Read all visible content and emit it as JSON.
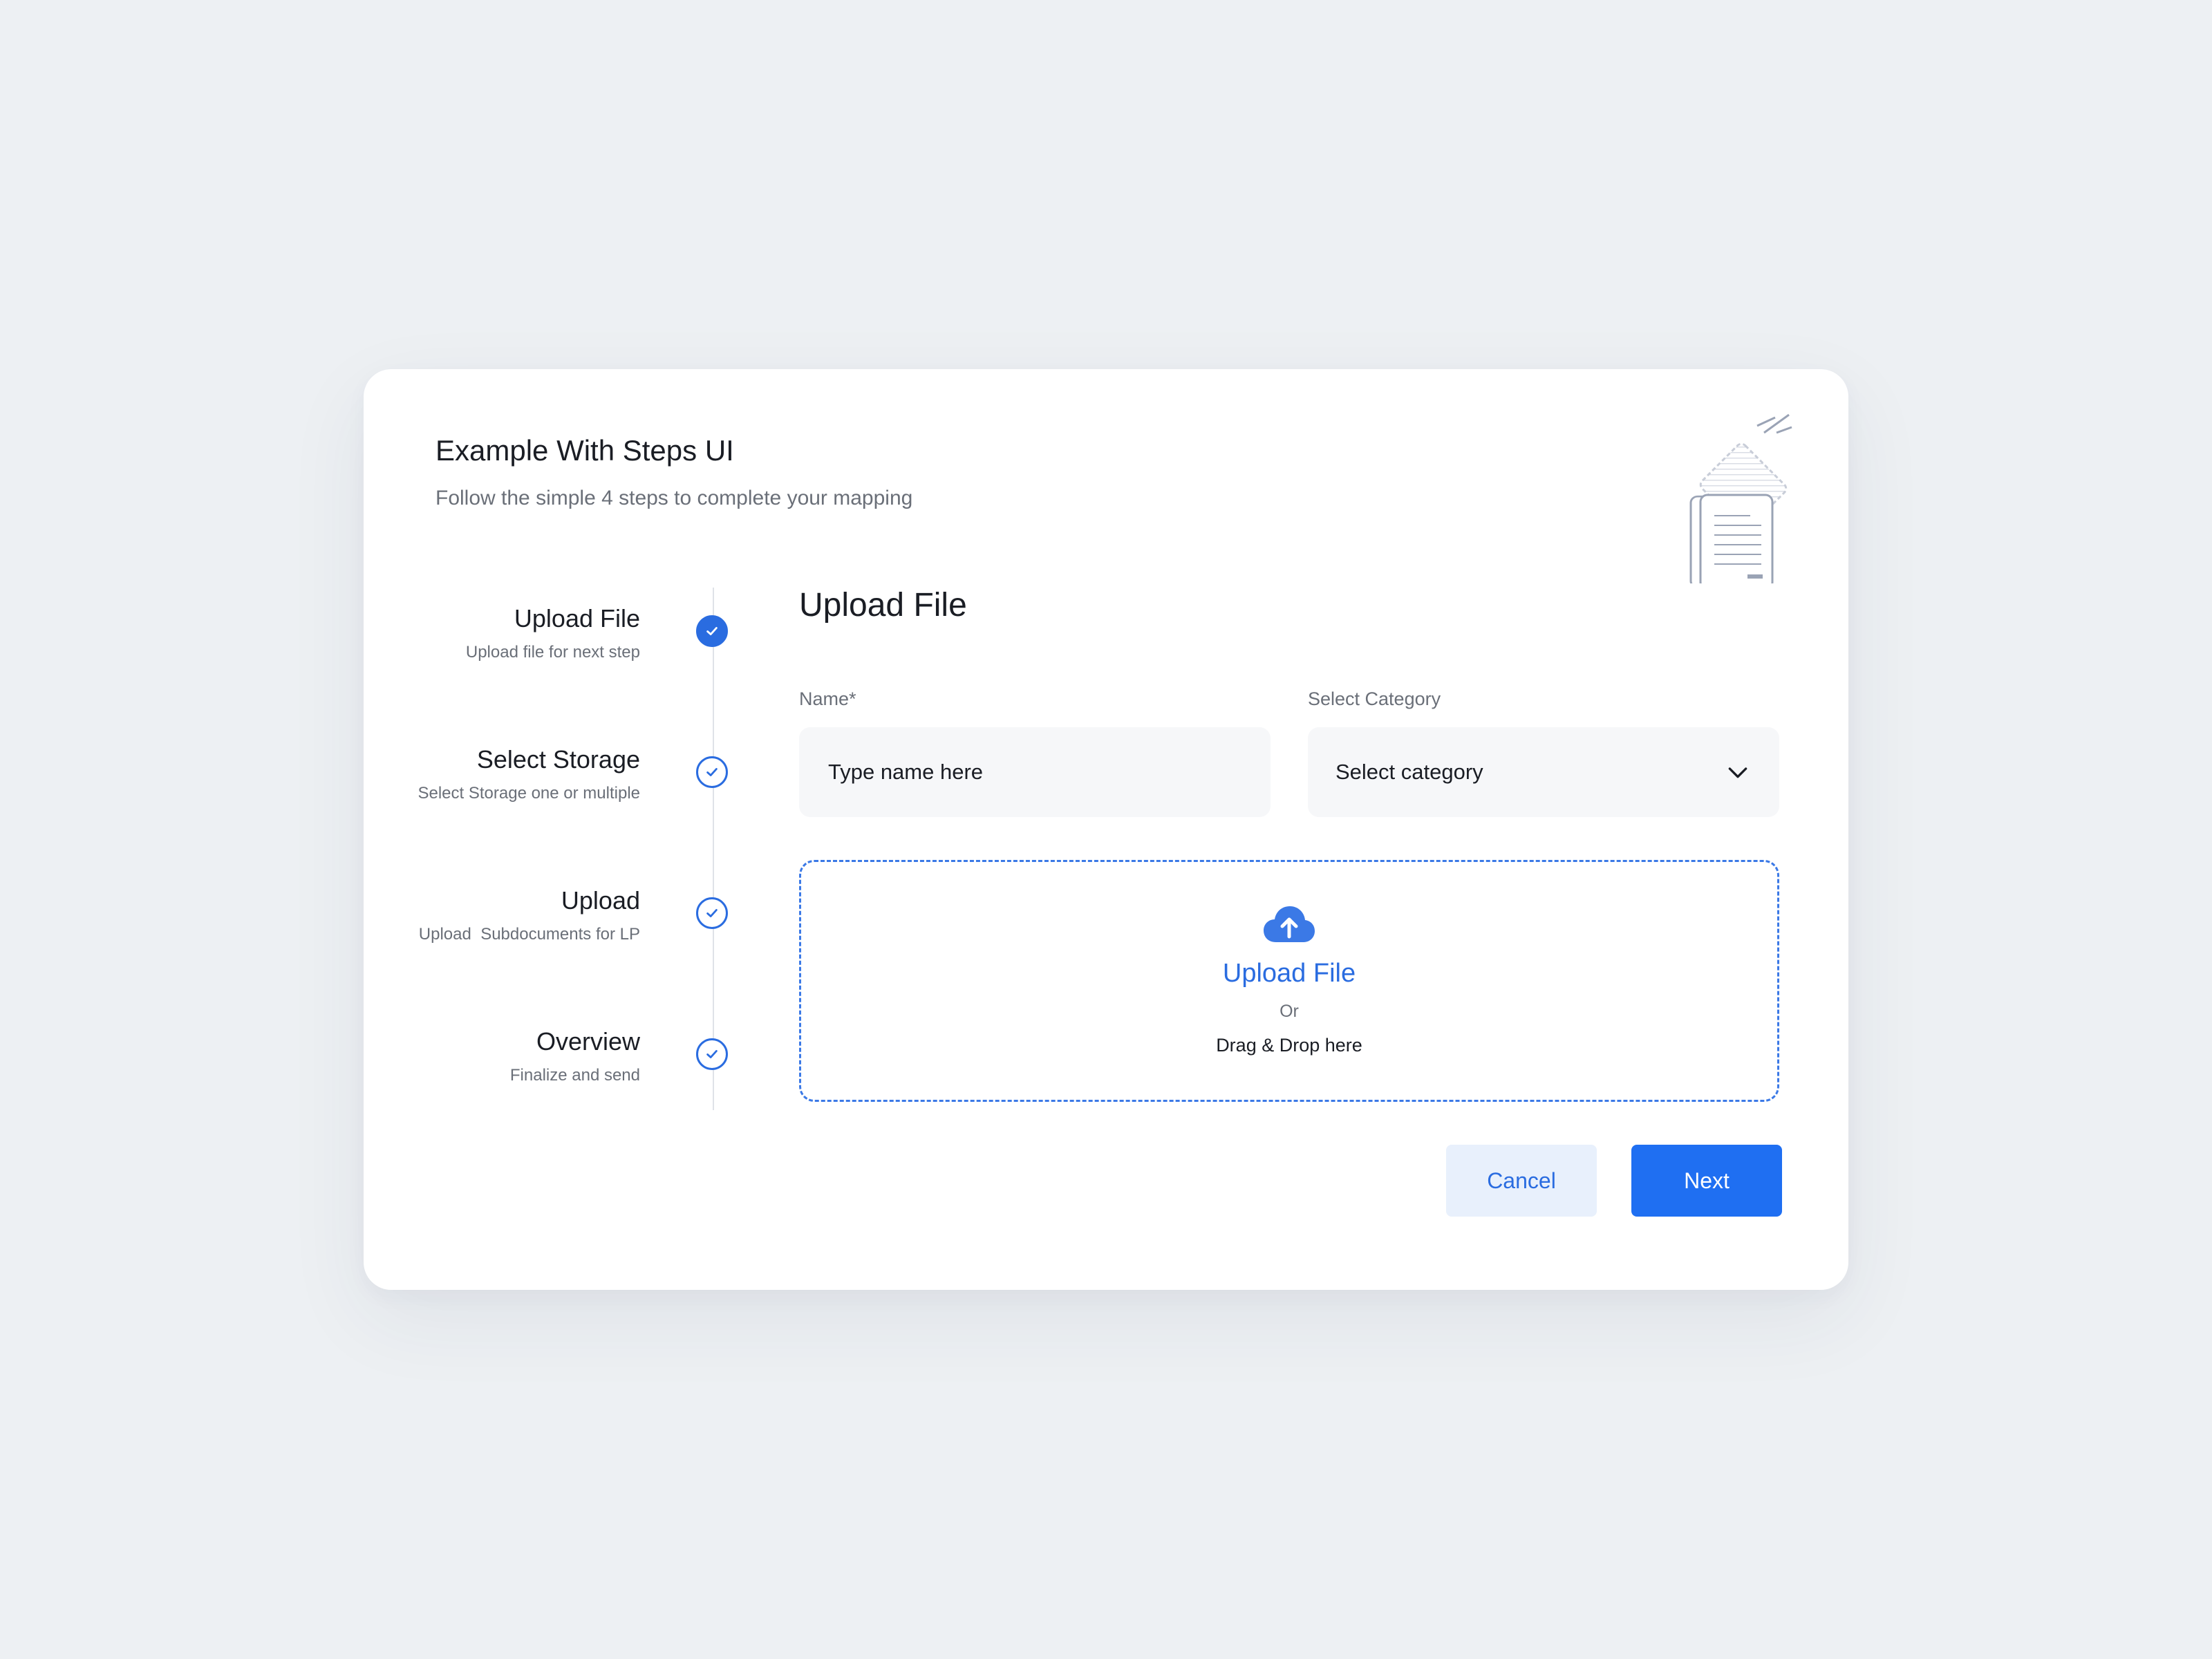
{
  "header": {
    "title": "Example With Steps UI",
    "subtitle": "Follow the simple 4 steps to complete your mapping"
  },
  "steps": [
    {
      "title": "Upload File",
      "description": "Upload file for next step",
      "state": "active"
    },
    {
      "title": "Select Storage",
      "description": "Select Storage one or multiple",
      "state": "pending"
    },
    {
      "title": "Upload",
      "description": "Upload  Subdocuments for LP",
      "state": "pending"
    },
    {
      "title": "Overview",
      "description": "Finalize and send",
      "state": "pending"
    }
  ],
  "main": {
    "section_title": "Upload File",
    "name_field": {
      "label": "Name*",
      "placeholder": "Type name here",
      "value": ""
    },
    "category_field": {
      "label": "Select Category",
      "selected": "Select category"
    },
    "dropzone": {
      "title": "Upload File",
      "or_text": "Or",
      "drag_text": "Drag & Drop here"
    }
  },
  "actions": {
    "cancel_label": "Cancel",
    "next_label": "Next"
  },
  "icons": {
    "step_check": "check-icon",
    "dropdown": "chevron-down-icon",
    "upload": "cloud-upload-icon",
    "illustration": "documents-illustration"
  },
  "colors": {
    "accent": "#2a6ce0",
    "primary_button": "#1f6ff2",
    "secondary_button_bg": "#e8f0fc",
    "page_bg": "#edf0f3"
  }
}
